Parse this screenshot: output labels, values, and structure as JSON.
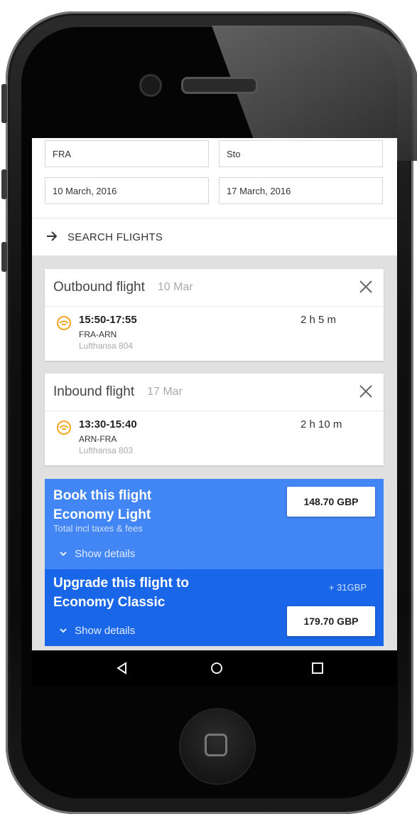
{
  "search": {
    "from": "FRA",
    "to": "Sto",
    "depart_date": "10 March, 2016",
    "return_date": "17 March, 2016",
    "button_label": "SEARCH FLIGHTS"
  },
  "outbound": {
    "title": "Outbound flight",
    "date": "10 Mar",
    "times": "15:50-17:55",
    "route": "FRA-ARN",
    "airline": "Lufthansa 804",
    "duration": "2 h 5 m"
  },
  "inbound": {
    "title": "Inbound flight",
    "date": "17 Mar",
    "times": "13:30-15:40",
    "route": "ARN-FRA",
    "airline": "Lufthansa 803",
    "duration": "2 h 10 m"
  },
  "booking": {
    "line1": "Book this flight",
    "line2": "Economy Light",
    "note": "Total incl taxes & fees",
    "price": "148.70 GBP",
    "details_label": "Show details"
  },
  "upgrade": {
    "line1": "Upgrade this flight to",
    "line2": "Economy Classic",
    "delta": "+ 31GBP",
    "price": "179.70 GBP",
    "details_label": "Show details"
  },
  "colors": {
    "book_bg": "#4285f4",
    "upgrade_bg": "#1a66e8",
    "airline_icon": "#f5a623"
  },
  "icons": {
    "arrow": "arrow-right-icon",
    "close": "close-icon",
    "airline": "lufthansa-crane-icon",
    "chevron": "chevron-down-icon",
    "back": "back-triangle-icon",
    "home": "home-circle-icon",
    "recents": "recents-square-icon"
  }
}
